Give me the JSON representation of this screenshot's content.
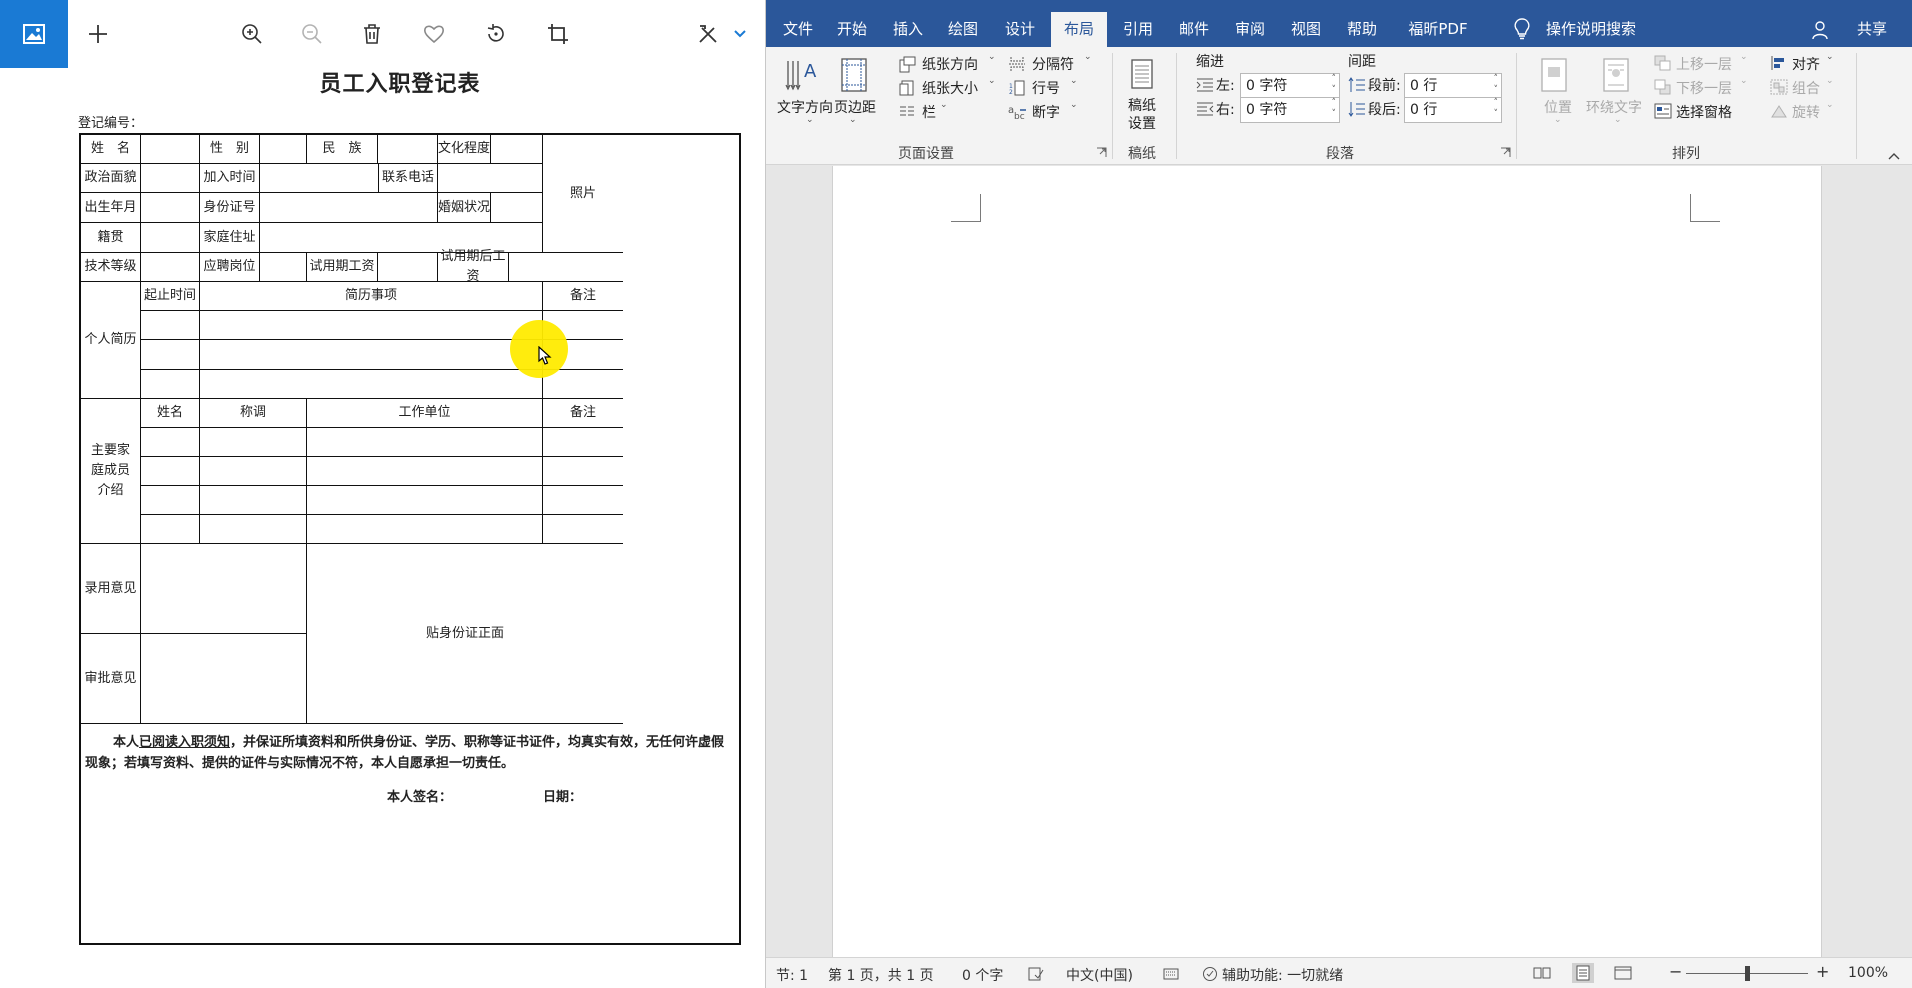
{
  "viewer": {
    "toolbar": {
      "photo_icon": "photo-icon",
      "add_icon": "plus-icon",
      "zoom_in_icon": "zoom-in-icon",
      "zoom_out_icon": "zoom-out-icon",
      "delete_icon": "trash-icon",
      "favorite_icon": "heart-icon",
      "rotate_icon": "rotate-icon",
      "crop_icon": "crop-icon",
      "edit_icon": "edit-icon",
      "accent_color": "#1a7ad4"
    },
    "form": {
      "title": "员工入职登记表",
      "reg_no_label": "登记编号：",
      "cells": {
        "name": "姓　名",
        "gender": "性　别",
        "ethnicity": "民　族",
        "education": "文化程度",
        "photo": "照片",
        "political": "政治面貌",
        "join_date": "加入时间",
        "phone": "联系电话",
        "birth": "出生年月",
        "id_no": "身份证号",
        "marital": "婚姻状况",
        "native": "籍贯",
        "address": "家庭住址",
        "tech_level": "技术等级",
        "position": "应聘岗位",
        "probation_pay": "试用期工资",
        "after_probation_pay": "试用期后工资",
        "resume": "个人简历",
        "period": "起止时间",
        "resume_items": "简历事项",
        "remarks": "备注",
        "family": "主要家庭成员介绍",
        "family_name": "姓名",
        "relation": "称调",
        "employer": "工作单位",
        "hire_opinion": "录用意见",
        "approval_opinion": "审批意见",
        "id_front": "贴身份证正面"
      },
      "declaration": {
        "pre": "本人",
        "underlined": "已阅读入职须知",
        "post": "，并保证所填资料和所供身份证、学历、职称等证书证件，均真实有效，无任何许虚假现象；若填写资料、提供的证件与实际情况不符，本人自愿承担一切责任。",
        "sign_label": "本人签名：",
        "date_label": "日期："
      }
    }
  },
  "word": {
    "tabs": [
      {
        "label": "文件"
      },
      {
        "label": "开始"
      },
      {
        "label": "插入"
      },
      {
        "label": "绘图"
      },
      {
        "label": "设计"
      },
      {
        "label": "布局"
      },
      {
        "label": "引用"
      },
      {
        "label": "邮件"
      },
      {
        "label": "审阅"
      },
      {
        "label": "视图"
      },
      {
        "label": "帮助"
      },
      {
        "label": "福昕PDF"
      }
    ],
    "active_tab": "布局",
    "tell_me": "操作说明搜索",
    "share": "共享",
    "brand_color": "#2b579a",
    "ribbon": {
      "text_direction": "文字方向",
      "margins": "页边距",
      "orientation": "纸张方向",
      "size": "纸张大小",
      "columns": "栏",
      "breaks": "分隔符",
      "line_numbers": "行号",
      "hyphenation": "断字",
      "page_setup_group": "页面设置",
      "draft_setup": "稿纸\n设置",
      "draft_group": "稿纸",
      "indent_label": "缩进",
      "spacing_label": "间距",
      "left_label": "左:",
      "right_label": "右:",
      "left_value": "0 字符",
      "right_value": "0 字符",
      "before_label": "段前:",
      "after_label": "段后:",
      "before_value": "0 行",
      "after_value": "0 行",
      "paragraph_group": "段落",
      "position": "位置",
      "wrap_text": "环绕文字",
      "bring_forward": "上移一层",
      "send_backward": "下移一层",
      "selection_pane": "选择窗格",
      "align": "对齐",
      "group": "组合",
      "rotate": "旋转",
      "arrange_group": "排列"
    },
    "status": {
      "section": "节: 1",
      "page": "第 1 页，共 1 页",
      "words": "0 个字",
      "language": "中文(中国)",
      "accessibility": "辅助功能: 一切就绪",
      "zoom": "100%",
      "zoom_value": 100
    }
  }
}
